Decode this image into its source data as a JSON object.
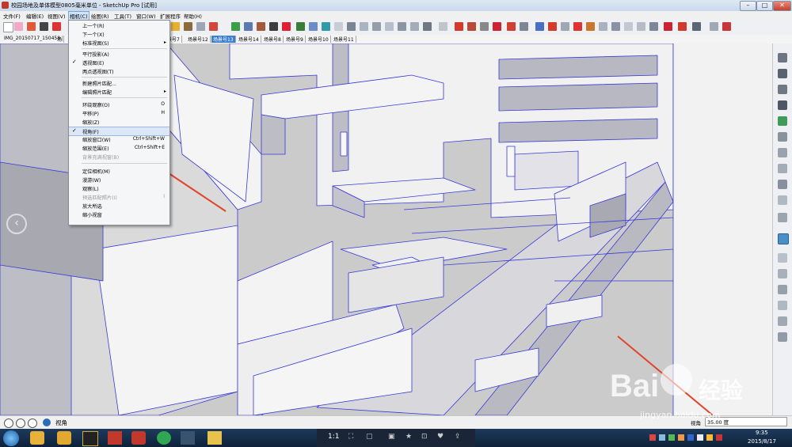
{
  "window": {
    "title": "校园场地及单体模型0805毫米单位 - SketchUp Pro [试用]",
    "controls": {
      "minimize": "–",
      "maximize": "□",
      "close": "✕"
    }
  },
  "menubar": {
    "items": [
      "文件(F)",
      "编辑(E)",
      "视图(V)",
      "相机(C)",
      "绘图(R)",
      "工具(T)",
      "窗口(W)",
      "扩展程序",
      "帮助(H)"
    ],
    "active": "相机(C)"
  },
  "scene_tabs": {
    "items": [
      "IMG_20150717_150458",
      "场",
      "场景号7",
      "场景号12",
      "场景号13",
      "场景号14",
      "场景号8",
      "场景号9",
      "场景号10",
      "场景号11"
    ],
    "selected": "场景号13"
  },
  "camera_menu": {
    "items": [
      {
        "label": "上一个(R)",
        "shortcut": "",
        "checked": false,
        "submenu": false,
        "disabled": false
      },
      {
        "label": "下一个(X)",
        "shortcut": "",
        "checked": false,
        "submenu": false,
        "disabled": false
      },
      {
        "label": "标准视图(S)",
        "shortcut": "",
        "checked": false,
        "submenu": true,
        "disabled": false
      },
      {
        "sep": true
      },
      {
        "label": "平行投影(A)",
        "shortcut": "",
        "checked": false,
        "submenu": false,
        "disabled": false
      },
      {
        "label": "透视图(E)",
        "shortcut": "",
        "checked": true,
        "submenu": false,
        "disabled": false
      },
      {
        "label": "两点透视图(T)",
        "shortcut": "",
        "checked": false,
        "submenu": false,
        "disabled": false
      },
      {
        "sep": true
      },
      {
        "label": "新建照片匹配...",
        "shortcut": "",
        "checked": false,
        "submenu": false,
        "disabled": false
      },
      {
        "label": "编辑照片匹配",
        "shortcut": "",
        "checked": false,
        "submenu": true,
        "disabled": false
      },
      {
        "sep": true
      },
      {
        "label": "环绕观察(O)",
        "shortcut": "O",
        "checked": false,
        "submenu": false,
        "disabled": false
      },
      {
        "label": "平移(P)",
        "shortcut": "H",
        "checked": false,
        "submenu": false,
        "disabled": false
      },
      {
        "label": "缩放(Z)",
        "shortcut": "",
        "checked": false,
        "submenu": false,
        "disabled": false
      },
      {
        "label": "视角(F)",
        "shortcut": "",
        "checked": true,
        "submenu": false,
        "disabled": false,
        "highlighted": true
      },
      {
        "label": "缩放窗口(W)",
        "shortcut": "Ctrl+Shift+W",
        "checked": false,
        "submenu": false,
        "disabled": false
      },
      {
        "label": "缩放范围(E)",
        "shortcut": "Ctrl+Shift+E",
        "checked": false,
        "submenu": false,
        "disabled": false
      },
      {
        "label": "背景充满视窗(B)",
        "shortcut": "",
        "checked": false,
        "submenu": false,
        "disabled": true
      },
      {
        "sep": true
      },
      {
        "label": "定位相机(M)",
        "shortcut": "",
        "checked": false,
        "submenu": false,
        "disabled": false
      },
      {
        "label": "漫游(W)",
        "shortcut": "",
        "checked": false,
        "submenu": false,
        "disabled": false
      },
      {
        "label": "观察(L)",
        "shortcut": "",
        "checked": false,
        "submenu": false,
        "disabled": false
      },
      {
        "label": "预选匹配照片(I)",
        "shortcut": "I",
        "checked": false,
        "submenu": false,
        "disabled": true
      },
      {
        "label": "放大所选",
        "shortcut": "",
        "checked": false,
        "submenu": false,
        "disabled": false
      },
      {
        "label": "缩小视窗",
        "shortcut": "",
        "checked": false,
        "submenu": false,
        "disabled": false
      }
    ]
  },
  "statusbar": {
    "message": "视角",
    "measurement_label": "视角",
    "measurement_value": "35.00 度"
  },
  "taskbar": {
    "pages": "1:1",
    "clock_time": "9:35",
    "clock_date": "2015/8/17"
  },
  "watermark": {
    "brand": "Bai",
    "suffix": "经验",
    "url": "jingyan.baidu.com"
  },
  "colors": {
    "edge": "#3838d8",
    "face": "#f2f2f2",
    "shade": "#b4b4bc",
    "ground": "#cbcbcb",
    "arrow": "#e0442a"
  }
}
